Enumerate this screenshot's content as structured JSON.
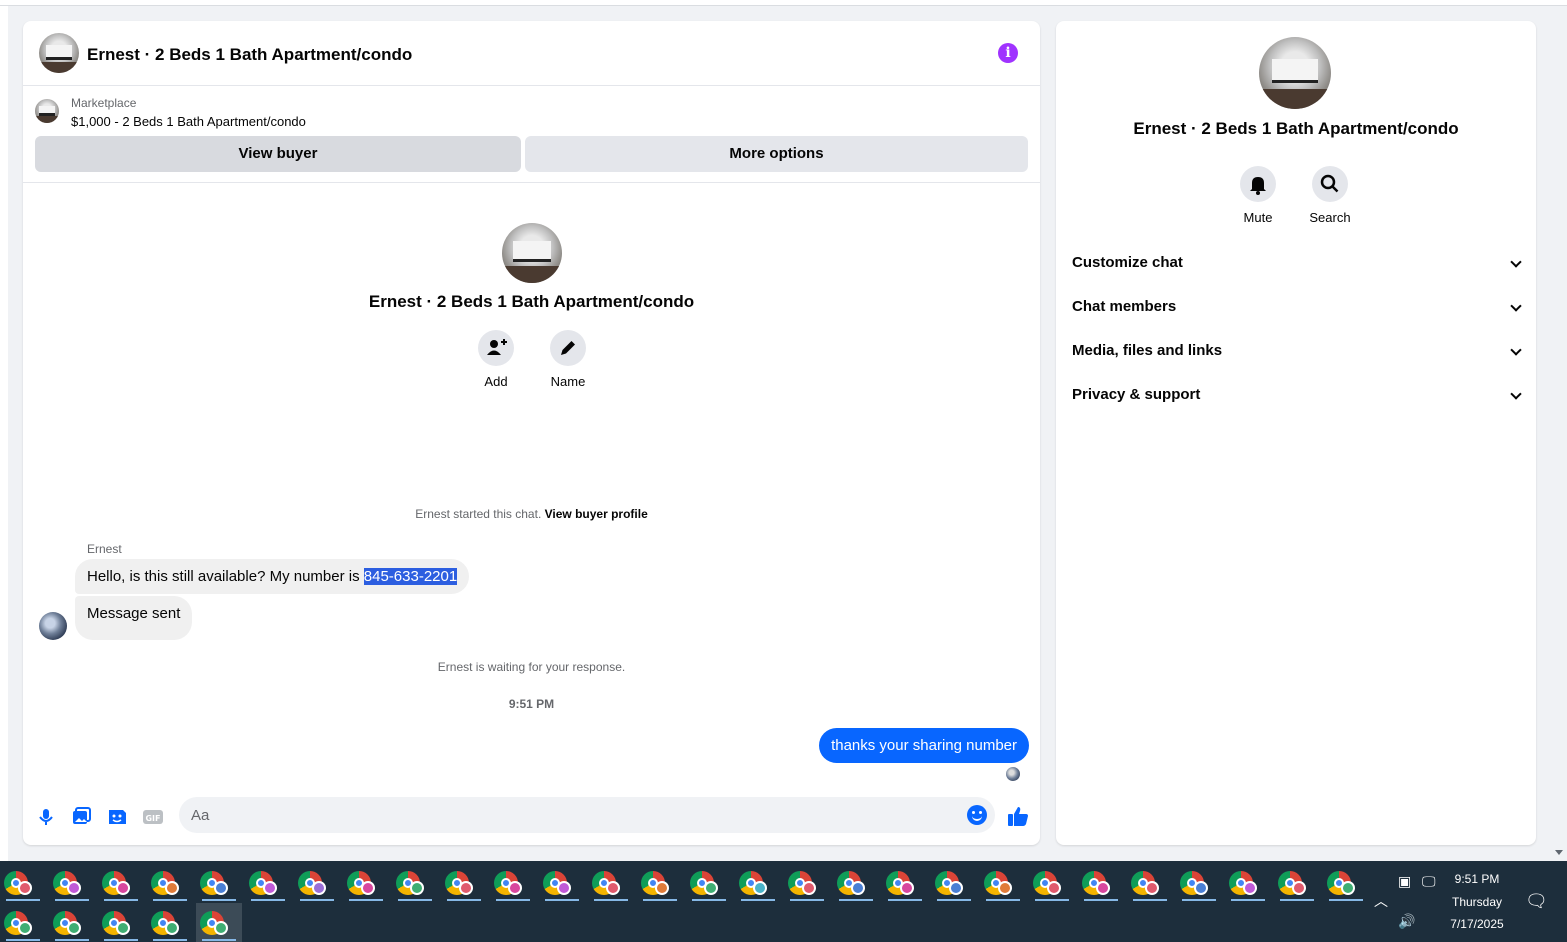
{
  "chat": {
    "title": "Ernest · 2 Beds 1 Bath Apartment/condo",
    "marketplace_label": "Marketplace",
    "listing": "$1,000 - 2 Beds 1 Bath Apartment/condo",
    "view_buyer_label": "View buyer",
    "more_options_label": "More options",
    "intro_title": "Ernest · 2 Beds 1 Bath Apartment/condo",
    "actions": {
      "add": "Add",
      "name": "Name"
    },
    "started_text": "Ernest started this chat.",
    "view_profile_link": "View buyer profile",
    "sender": "Ernest",
    "msg1_text": "Hello, is this still available? My number is ",
    "msg1_number": "845-633-2201",
    "msg2_text": "Message sent",
    "waiting_text": "Ernest is waiting for your response.",
    "time": "9:51 PM",
    "outgoing": "thanks your sharing number",
    "composer_placeholder": "Aa"
  },
  "side": {
    "title": "Ernest · 2 Beds 1 Bath Apartment/condo",
    "mute_label": "Mute",
    "search_label": "Search",
    "sections": [
      "Customize chat",
      "Chat members",
      "Media, files and links",
      "Privacy & support"
    ]
  },
  "taskbar": {
    "time": "9:51 PM",
    "day": "Thursday",
    "date": "7/17/2025",
    "badge_colors": [
      "#e05a6d",
      "#c05ad8",
      "#d8479e",
      "#e07b39",
      "#4a7fd4",
      "#c05ad8",
      "#9b6fd8",
      "#d8479e",
      "#3fae73",
      "#e05a6d",
      "#d8479e",
      "#c05ad8",
      "#e05a6d",
      "#e07b39",
      "#3fae73",
      "#4ab3c9",
      "#e05a6d",
      "#4a7fd4",
      "#d8479e",
      "#4a7fd4",
      "#e07b39",
      "#e05a6d",
      "#d8479e",
      "#e05a6d",
      "#4a7fd4",
      "#c05ad8",
      "#e05a6d",
      "#3fae73"
    ],
    "row2_badge_colors": [
      "#3fae73",
      "#3fae73",
      "#3fae73",
      "#3fae73",
      "#3fae73"
    ]
  }
}
